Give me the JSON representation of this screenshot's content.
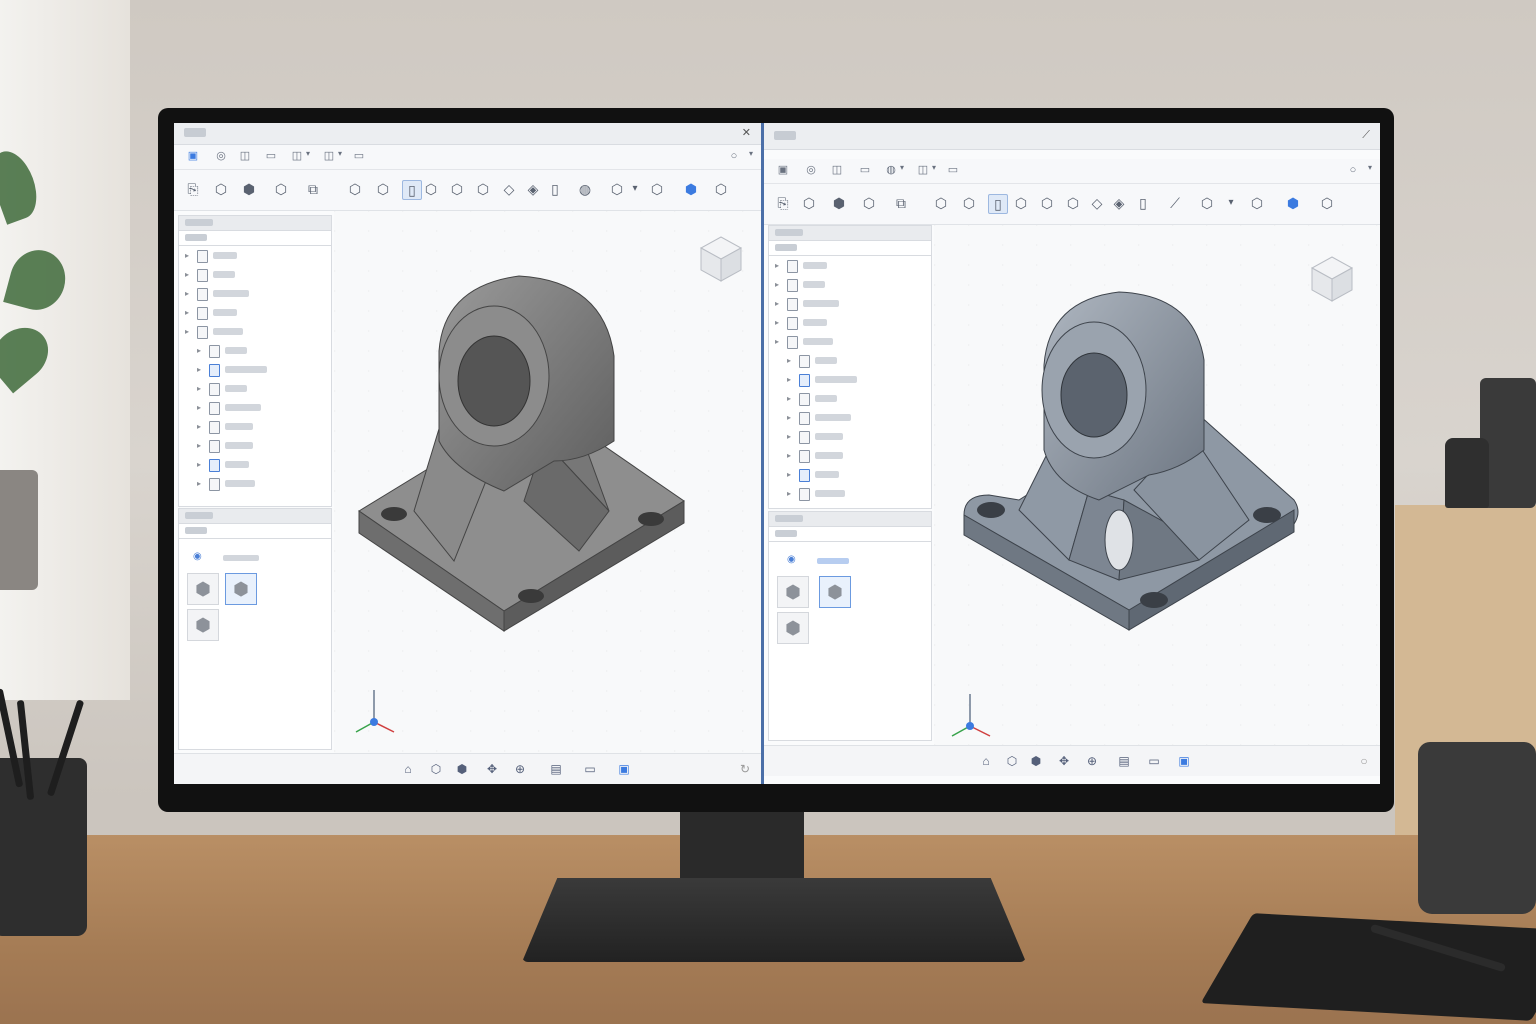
{
  "colors": {
    "accent": "#3c7be0",
    "part_left": "#7c7c7c",
    "part_right": "#8e98a4",
    "divider": "#4b6fa8"
  },
  "left_window": {
    "close_icon": "close-icon",
    "menu_icons": [
      "document-icon",
      "view-icon",
      "view-icon",
      "folder-icon",
      "folder-icon",
      "folder-icon"
    ],
    "toolbar_icons": [
      "new-sketch-icon",
      "cube-icon",
      "extrude-icon",
      "cube-icon",
      "assembly-icon",
      "box-icon",
      "cube-icon",
      "constraint-icon",
      "cube-icon",
      "shell-icon",
      "cube-icon",
      "fillet-icon",
      "chamfer-icon",
      "clipboard-icon",
      "pattern-icon",
      "cube-icon",
      "chevron-down-icon",
      "solid-icon",
      "blue-cube-icon",
      "cube-icon"
    ],
    "tree_rows": 13,
    "library_cubes": 3,
    "statusbar_icons": [
      "home-view-icon",
      "cube-icon",
      "cube-icon",
      "orbit-icon",
      "pan-icon",
      "section-icon",
      "display-icon",
      "render-icon"
    ]
  },
  "right_window": {
    "close_icon": "pin-icon",
    "menu_icons": [
      "document-icon",
      "view-icon",
      "folder-icon",
      "folder-icon",
      "folder-icon",
      "folder-icon"
    ],
    "toolbar_icons": [
      "new-sketch-icon",
      "cube-icon",
      "extrude-icon",
      "cube-icon",
      "assembly-icon",
      "box-icon",
      "cube-icon",
      "constraint-icon",
      "cube-icon",
      "shell-icon",
      "cube-icon",
      "fillet-icon",
      "chamfer-icon",
      "clipboard-icon",
      "pattern-icon",
      "cube-icon",
      "chevron-down-icon",
      "solid-icon",
      "blue-cube-icon",
      "cube-icon"
    ],
    "tree_rows": 13,
    "library_cubes": 3,
    "statusbar_icons": [
      "home-view-icon",
      "cube-icon",
      "cube-icon",
      "orbit-icon",
      "pan-icon",
      "section-icon",
      "display-icon",
      "render-icon"
    ]
  }
}
